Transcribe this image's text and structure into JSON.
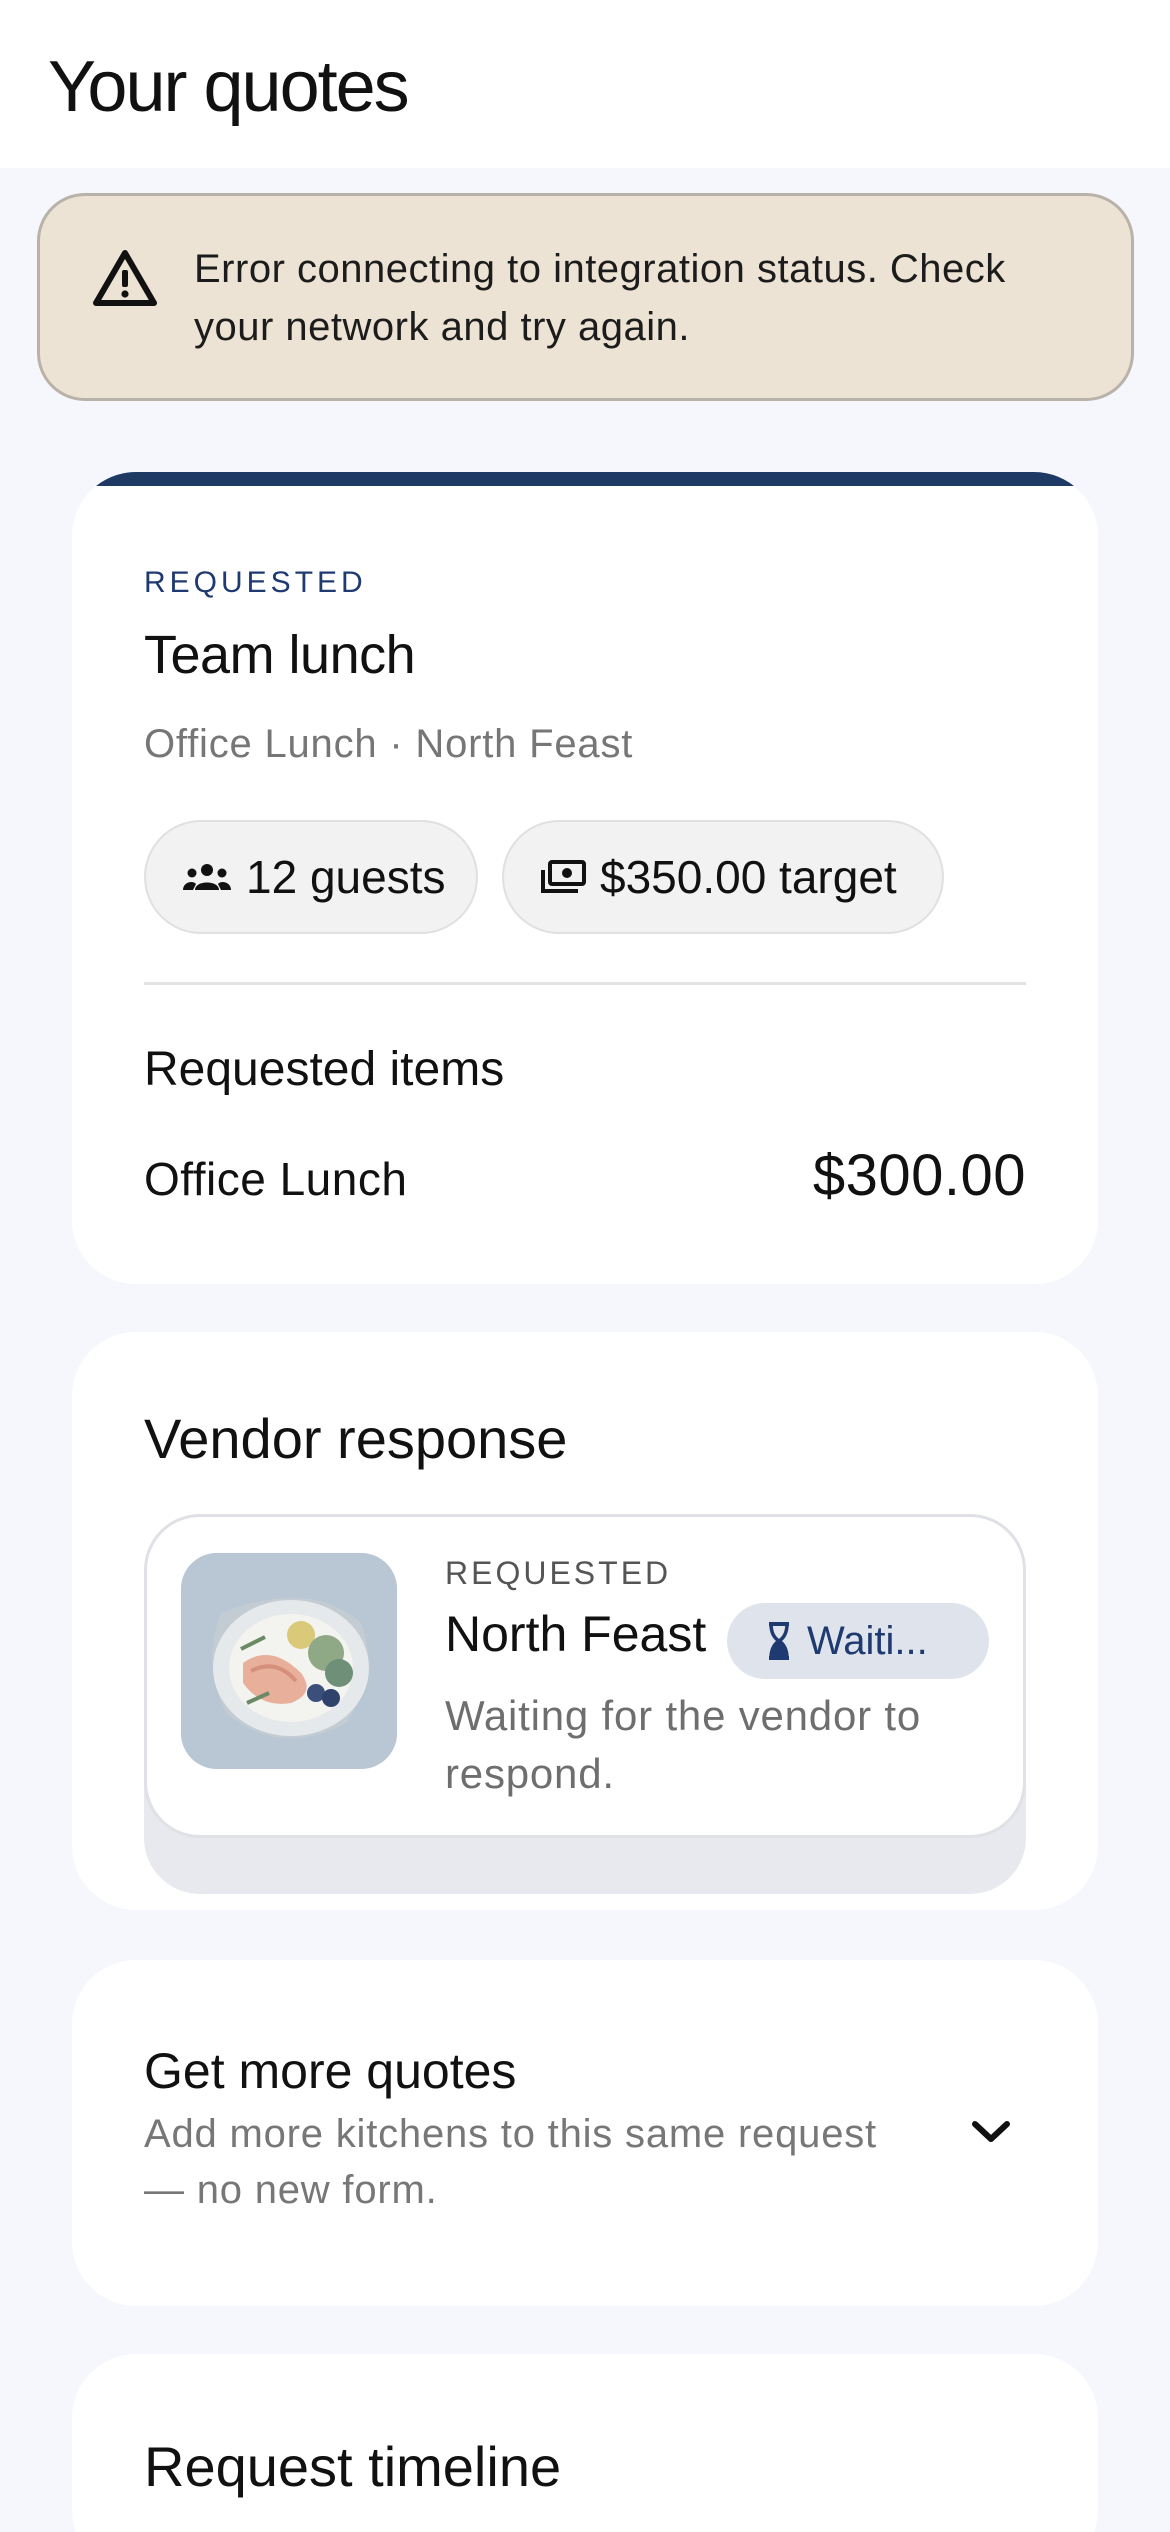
{
  "page": {
    "title": "Your quotes"
  },
  "alert": {
    "icon": "warning-triangle-icon",
    "message": "Error connecting to integration status. Check your network and try again."
  },
  "quote": {
    "status": "REQUESTED",
    "title": "Team lunch",
    "subtitle": "Office Lunch · North Feast",
    "guests_chip": {
      "icon": "group-icon",
      "label": "12 guests"
    },
    "target_chip": {
      "icon": "cash-icon",
      "label": "$350.00 target"
    },
    "items_heading": "Requested items",
    "items": [
      {
        "name": "Office Lunch",
        "price": "$300.00"
      }
    ]
  },
  "vendor_response": {
    "heading": "Vendor response",
    "vendor": {
      "status": "REQUESTED",
      "name": "North Feast",
      "badge": {
        "icon": "hourglass-icon",
        "label": "Waiti..."
      },
      "message": "Waiting for the vendor to respond."
    }
  },
  "more_quotes": {
    "title": "Get more quotes",
    "subtitle": "Add more kitchens to this same request — no new form.",
    "icon": "chevron-down-icon"
  },
  "timeline": {
    "title": "Request timeline"
  },
  "colors": {
    "background": "#f5f7fc",
    "alert_bg": "#ede3d4",
    "accent": "#1e3a64",
    "badge_bg": "#dfe4ec"
  }
}
